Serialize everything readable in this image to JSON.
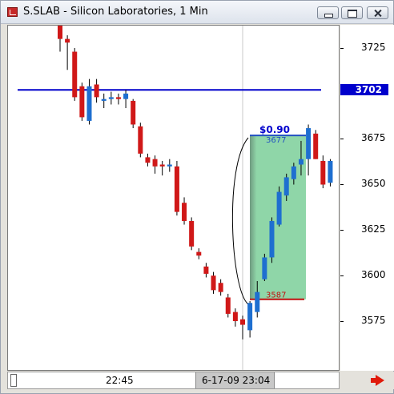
{
  "window": {
    "title": "S.SLAB - Silicon Laboratories, 1 Min",
    "icon": "chart-app-icon"
  },
  "controls": {
    "minimize_icon": "minimize-icon",
    "maximize_icon": "maximize-icon",
    "close_icon": "close-icon"
  },
  "price_axis": {
    "ticks": [
      "3725",
      "3700",
      "3675",
      "3650",
      "3625",
      "3600",
      "3575"
    ],
    "current_price": "3702",
    "current_price_color": "#0000cc"
  },
  "time_axis": {
    "label": "22:45",
    "cursor_label": "6-17-09 23:04"
  },
  "annotation": {
    "profit": "$0.90",
    "high": "3677",
    "low": "3587",
    "profit_color": "#0000cc",
    "high_color": "#2050c0",
    "low_color": "#c01010",
    "fill_color": "#8fd6a8"
  },
  "colors": {
    "up": "#1e6fd0",
    "down": "#d01818",
    "hline": "#0000cc"
  },
  "nav": {
    "arrow_icon": "scroll-right-arrow-icon"
  },
  "chart_data": {
    "type": "candlestick",
    "interval": "1 Min",
    "symbol": "S.SLAB",
    "ylim": [
      3560,
      3743
    ],
    "hline": 3702,
    "candles": [
      {
        "o": 3743,
        "h": 3745,
        "l": 3723,
        "c": 3730
      },
      {
        "o": 3730,
        "h": 3732,
        "l": 3713,
        "c": 3728
      },
      {
        "o": 3723,
        "h": 3725,
        "l": 3696,
        "c": 3698
      },
      {
        "o": 3704,
        "h": 3706,
        "l": 3685,
        "c": 3687
      },
      {
        "o": 3685,
        "h": 3708,
        "l": 3683,
        "c": 3704
      },
      {
        "o": 3705,
        "h": 3708,
        "l": 3695,
        "c": 3698
      },
      {
        "o": 3696,
        "h": 3700,
        "l": 3692,
        "c": 3697
      },
      {
        "o": 3697,
        "h": 3701,
        "l": 3694,
        "c": 3698
      },
      {
        "o": 3698,
        "h": 3700,
        "l": 3694,
        "c": 3697
      },
      {
        "o": 3697,
        "h": 3702,
        "l": 3692,
        "c": 3700
      },
      {
        "o": 3696,
        "h": 3697,
        "l": 3681,
        "c": 3683
      },
      {
        "o": 3682,
        "h": 3684,
        "l": 3665,
        "c": 3667
      },
      {
        "o": 3665,
        "h": 3667,
        "l": 3660,
        "c": 3662
      },
      {
        "o": 3664,
        "h": 3666,
        "l": 3656,
        "c": 3660
      },
      {
        "o": 3661,
        "h": 3663,
        "l": 3655,
        "c": 3660
      },
      {
        "o": 3660,
        "h": 3664,
        "l": 3657,
        "c": 3661
      },
      {
        "o": 3660,
        "h": 3663,
        "l": 3633,
        "c": 3635
      },
      {
        "o": 3640,
        "h": 3643,
        "l": 3628,
        "c": 3630
      },
      {
        "o": 3630,
        "h": 3632,
        "l": 3614,
        "c": 3616
      },
      {
        "o": 3613,
        "h": 3615,
        "l": 3609,
        "c": 3611
      },
      {
        "o": 3605,
        "h": 3607,
        "l": 3599,
        "c": 3601
      },
      {
        "o": 3600,
        "h": 3602,
        "l": 3590,
        "c": 3592
      },
      {
        "o": 3596,
        "h": 3598,
        "l": 3589,
        "c": 3591
      },
      {
        "o": 3588,
        "h": 3590,
        "l": 3577,
        "c": 3579
      },
      {
        "o": 3580,
        "h": 3582,
        "l": 3572,
        "c": 3575
      },
      {
        "o": 3576,
        "h": 3578,
        "l": 3565,
        "c": 3573
      },
      {
        "o": 3570,
        "h": 3586,
        "l": 3566,
        "c": 3585
      },
      {
        "o": 3580,
        "h": 3597,
        "l": 3577,
        "c": 3591
      },
      {
        "o": 3598,
        "h": 3612,
        "l": 3597,
        "c": 3610
      },
      {
        "o": 3610,
        "h": 3632,
        "l": 3607,
        "c": 3630
      },
      {
        "o": 3628,
        "h": 3649,
        "l": 3627,
        "c": 3646
      },
      {
        "o": 3644,
        "h": 3656,
        "l": 3641,
        "c": 3654
      },
      {
        "o": 3653,
        "h": 3662,
        "l": 3650,
        "c": 3660
      },
      {
        "o": 3661,
        "h": 3674,
        "l": 3655,
        "c": 3664
      },
      {
        "o": 3664,
        "h": 3683,
        "l": 3655,
        "c": 3681
      },
      {
        "o": 3678,
        "h": 3680,
        "l": 3664,
        "c": 3664
      },
      {
        "o": 3663,
        "h": 3666,
        "l": 3648,
        "c": 3650
      },
      {
        "o": 3651,
        "h": 3664,
        "l": 3649,
        "c": 3663
      }
    ]
  }
}
